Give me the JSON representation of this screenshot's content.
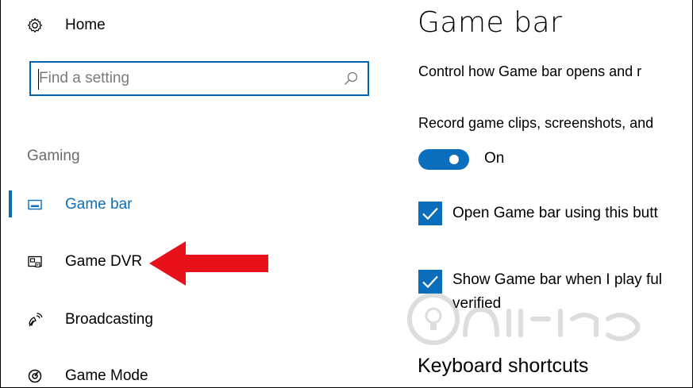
{
  "sidebar": {
    "home_label": "Home",
    "search_placeholder": "Find a setting",
    "section_label": "Gaming",
    "items": [
      {
        "label": "Game bar",
        "icon": "game-bar-icon",
        "active": true
      },
      {
        "label": "Game DVR",
        "icon": "game-dvr-icon",
        "active": false
      },
      {
        "label": "Broadcasting",
        "icon": "broadcasting-icon",
        "active": false
      },
      {
        "label": "Game Mode",
        "icon": "game-mode-icon",
        "active": false
      }
    ]
  },
  "main": {
    "title": "Game bar",
    "description": "Control how Game bar opens and r",
    "record_label": "Record game clips, screenshots, and",
    "toggle_state": "On",
    "checkbox1_label": "Open Game bar using this butt",
    "checkbox2_label_line1": "Show Game bar when I play ful",
    "checkbox2_label_line2": "verified",
    "keyboard_title": "Keyboard shortcuts"
  },
  "colors": {
    "accent": "#0a6ebd",
    "arrow": "#e8101a"
  }
}
